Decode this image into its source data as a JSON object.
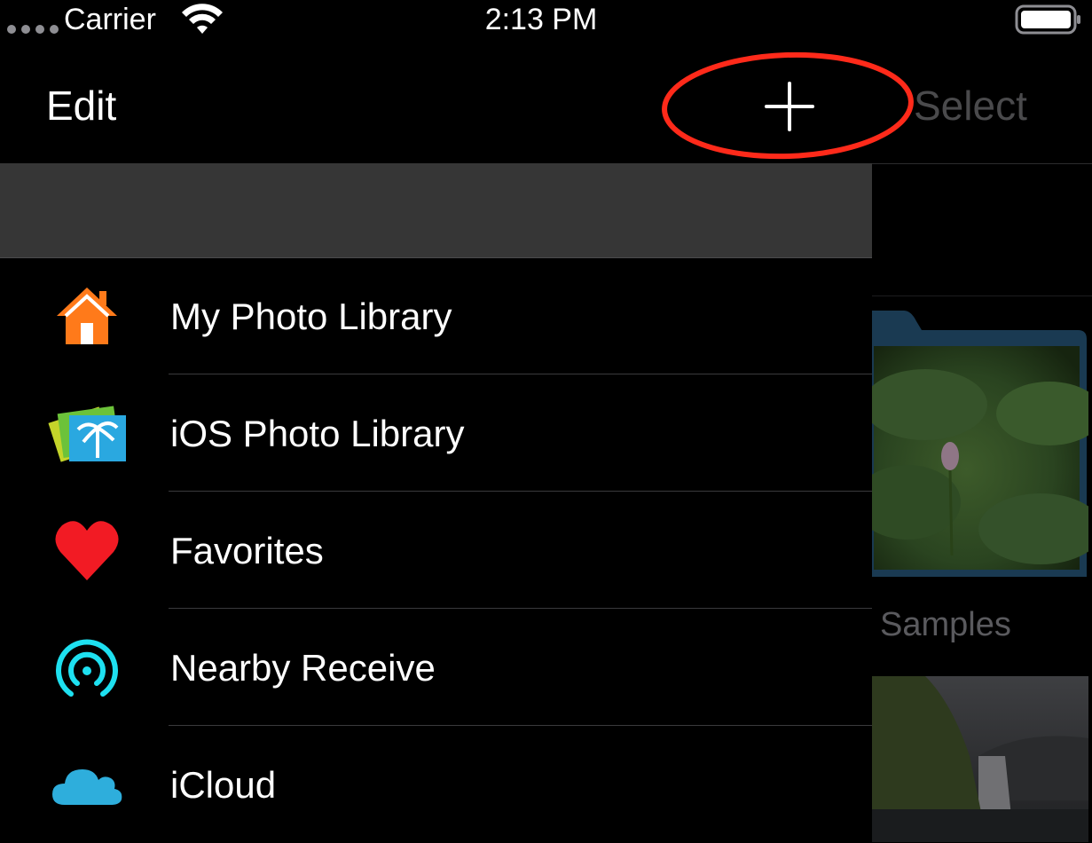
{
  "status_bar": {
    "carrier": "Carrier",
    "time": "2:13 PM"
  },
  "nav": {
    "edit_label": "Edit",
    "select_label": "Select",
    "add_icon": "plus-icon",
    "highlight_color": "#ff2a1a"
  },
  "background": {
    "folder_label": "Samples"
  },
  "drawer": {
    "items": [
      {
        "label": "My Photo Library",
        "icon": "home-icon",
        "color": "#ff7a1a"
      },
      {
        "label": "iOS Photo Library",
        "icon": "photos-icon",
        "color": "#2aa8e0"
      },
      {
        "label": "Favorites",
        "icon": "heart-icon",
        "color": "#f21b24"
      },
      {
        "label": "Nearby Receive",
        "icon": "airdrop-icon",
        "color": "#1ee0f0"
      },
      {
        "label": "iCloud",
        "icon": "cloud-icon",
        "color": "#2eaedc"
      }
    ]
  }
}
